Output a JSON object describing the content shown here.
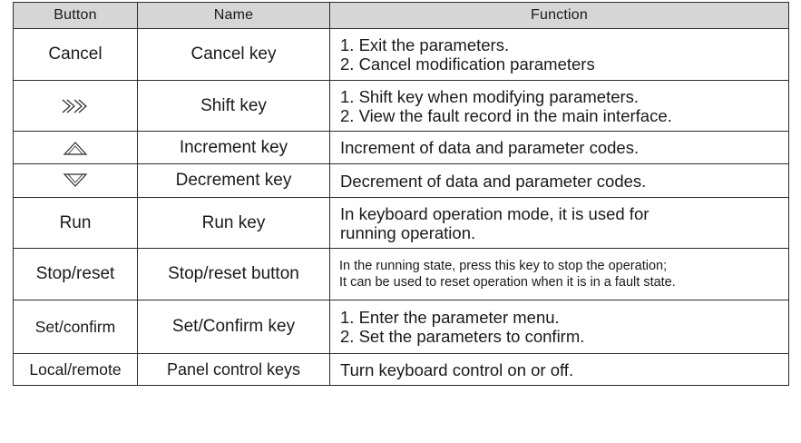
{
  "headers": {
    "button": "Button",
    "name": "Name",
    "function": "Function"
  },
  "rows": [
    {
      "button": "Cancel",
      "name": "Cancel key",
      "function": [
        "1. Exit the parameters.",
        "2. Cancel modification parameters"
      ]
    },
    {
      "button_icon": "double-chevron-right-icon",
      "name": "Shift key",
      "function": [
        "1. Shift key when modifying parameters.",
        "2. View the fault record in the main interface."
      ]
    },
    {
      "button_icon": "up-triangle-icon",
      "name": "Increment key",
      "function": [
        "Increment of data and parameter codes."
      ]
    },
    {
      "button_icon": "down-triangle-icon",
      "name": "Decrement key",
      "function": [
        "Decrement of data and parameter codes."
      ]
    },
    {
      "button": "Run",
      "name": "Run key",
      "function": [
        "In keyboard operation mode, it is used for",
        "running operation."
      ]
    },
    {
      "button": "Stop/reset",
      "name": "Stop/reset button",
      "function": [
        "In the running state, press this key to stop the operation;",
        "It can be used to reset operation when it is in a fault state."
      ]
    },
    {
      "button": "Set/confirm",
      "name": "Set/Confirm key",
      "function": [
        "1. Enter the parameter menu.",
        "2. Set the parameters to confirm."
      ]
    },
    {
      "button": "Local/remote",
      "name": "Panel control keys",
      "function": [
        "Turn keyboard control on or off."
      ]
    }
  ],
  "colors": {
    "header_bg": "#d6d6d6",
    "border": "#2b2b2b",
    "text": "#1a1a1a"
  }
}
